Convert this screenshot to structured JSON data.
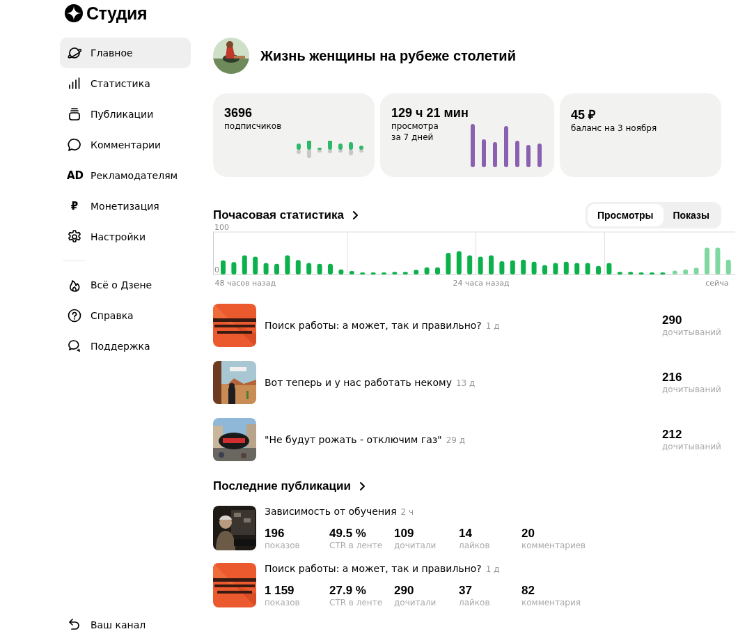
{
  "logo": {
    "text": "Студия"
  },
  "sidebar": {
    "groups": [
      {
        "items": [
          {
            "label": "Главное",
            "selected": true
          },
          {
            "label": "Статистика",
            "selected": false
          },
          {
            "label": "Публикации",
            "selected": false
          },
          {
            "label": "Комментарии",
            "selected": false
          },
          {
            "label": "Рекламодателям",
            "glyph": "AD",
            "selected": false
          },
          {
            "label": "Монетизация",
            "glyph": "₽",
            "selected": false
          },
          {
            "label": "Настройки",
            "selected": false
          }
        ]
      },
      {
        "items": [
          {
            "label": "Всё о Дзене",
            "selected": false
          },
          {
            "label": "Справка",
            "selected": false
          },
          {
            "label": "Поддержка",
            "selected": false
          }
        ]
      }
    ],
    "footer": {
      "label": "Ваш канал"
    }
  },
  "channel": {
    "title": "Жизнь женщины на рубеже столетий"
  },
  "summary_cards": [
    {
      "kind": "sparkline",
      "value": "3696",
      "caption": [
        "подписчиков"
      ]
    },
    {
      "kind": "bars",
      "value": "129 ч 21 мин",
      "caption": [
        "просмотра",
        "за 7 дней"
      ]
    },
    {
      "kind": "plain",
      "value": "45 ₽",
      "caption": [
        "баланс на 3 ноября"
      ]
    }
  ],
  "hourly": {
    "title": "Почасовая статистика",
    "tabs": [
      {
        "label": "Просмотры",
        "selected": true
      },
      {
        "label": "Показы",
        "selected": false
      }
    ],
    "chart_data": {
      "type": "bar",
      "stacked": false,
      "yticks": [
        0,
        100
      ],
      "ylim": [
        0,
        100
      ],
      "categories": [
        null,
        null,
        "48 часов назад",
        null,
        null,
        null,
        null,
        null,
        null,
        null,
        null,
        null,
        null,
        null,
        null,
        null,
        null,
        null,
        null,
        null,
        null,
        null,
        null,
        null,
        "24 часа назад",
        null,
        null,
        null,
        null,
        null,
        null,
        null,
        null,
        null,
        null,
        null,
        null,
        null,
        null,
        null,
        null,
        null,
        null,
        null,
        null,
        null,
        "сейча",
        null
      ],
      "series": [
        {
          "color": "#0bb14a",
          "values": [
            33,
            29,
            45,
            42,
            27,
            25,
            45,
            34,
            27,
            25,
            25,
            12,
            8,
            5,
            5,
            5,
            6,
            6,
            11,
            17,
            17,
            51,
            55,
            45,
            42,
            45,
            31,
            33,
            35,
            30,
            22,
            27,
            30,
            27,
            27,
            20,
            27,
            6,
            6,
            5,
            5,
            5,
            null,
            null,
            null,
            null,
            null,
            null
          ]
        },
        {
          "color": "#7fd89f",
          "values": [
            null,
            null,
            null,
            null,
            null,
            null,
            null,
            null,
            null,
            null,
            null,
            null,
            null,
            null,
            null,
            null,
            null,
            null,
            null,
            null,
            null,
            null,
            null,
            null,
            null,
            null,
            null,
            null,
            null,
            null,
            null,
            null,
            null,
            null,
            null,
            null,
            null,
            null,
            null,
            null,
            null,
            null,
            9,
            12,
            16,
            63,
            63,
            35
          ]
        }
      ]
    }
  },
  "top_posts": [
    {
      "title": "Поиск работы: а может, так и правильно?",
      "age": "1 д",
      "value": "290",
      "caption": "дочитываний",
      "kind": "picture"
    },
    {
      "title": "Вот теперь и у нас работать некому",
      "age": "13 д",
      "value": "216",
      "caption": "дочитываний",
      "kind": "picture"
    },
    {
      "title": "\"Не будут рожать - отключим газ\"",
      "age": "29 д",
      "value": "212",
      "caption": "дочитываний",
      "kind": "picture"
    }
  ],
  "latest": {
    "title": "Последние публикации",
    "posts": [
      {
        "title": "Зависимость от обучения",
        "age": "2 ч",
        "kind": "picture",
        "stats": [
          {
            "value": "196",
            "caption": "показов"
          },
          {
            "value": "49.5 %",
            "caption": "CTR в ленте"
          },
          {
            "value": "109",
            "caption": "дочитали"
          },
          {
            "value": "14",
            "caption": "лайков"
          },
          {
            "value": "20",
            "caption": "комментариев"
          }
        ]
      },
      {
        "title": "Поиск работы: а может, так и правильно?",
        "age": "1 д",
        "kind": "picture",
        "stats": [
          {
            "value": "1 159",
            "caption": "показов"
          },
          {
            "value": "27.9 %",
            "caption": "CTR в ленте"
          },
          {
            "value": "290",
            "caption": "дочитали"
          },
          {
            "value": "37",
            "caption": "лайков"
          },
          {
            "value": "82",
            "caption": "комментария"
          }
        ]
      }
    ]
  }
}
